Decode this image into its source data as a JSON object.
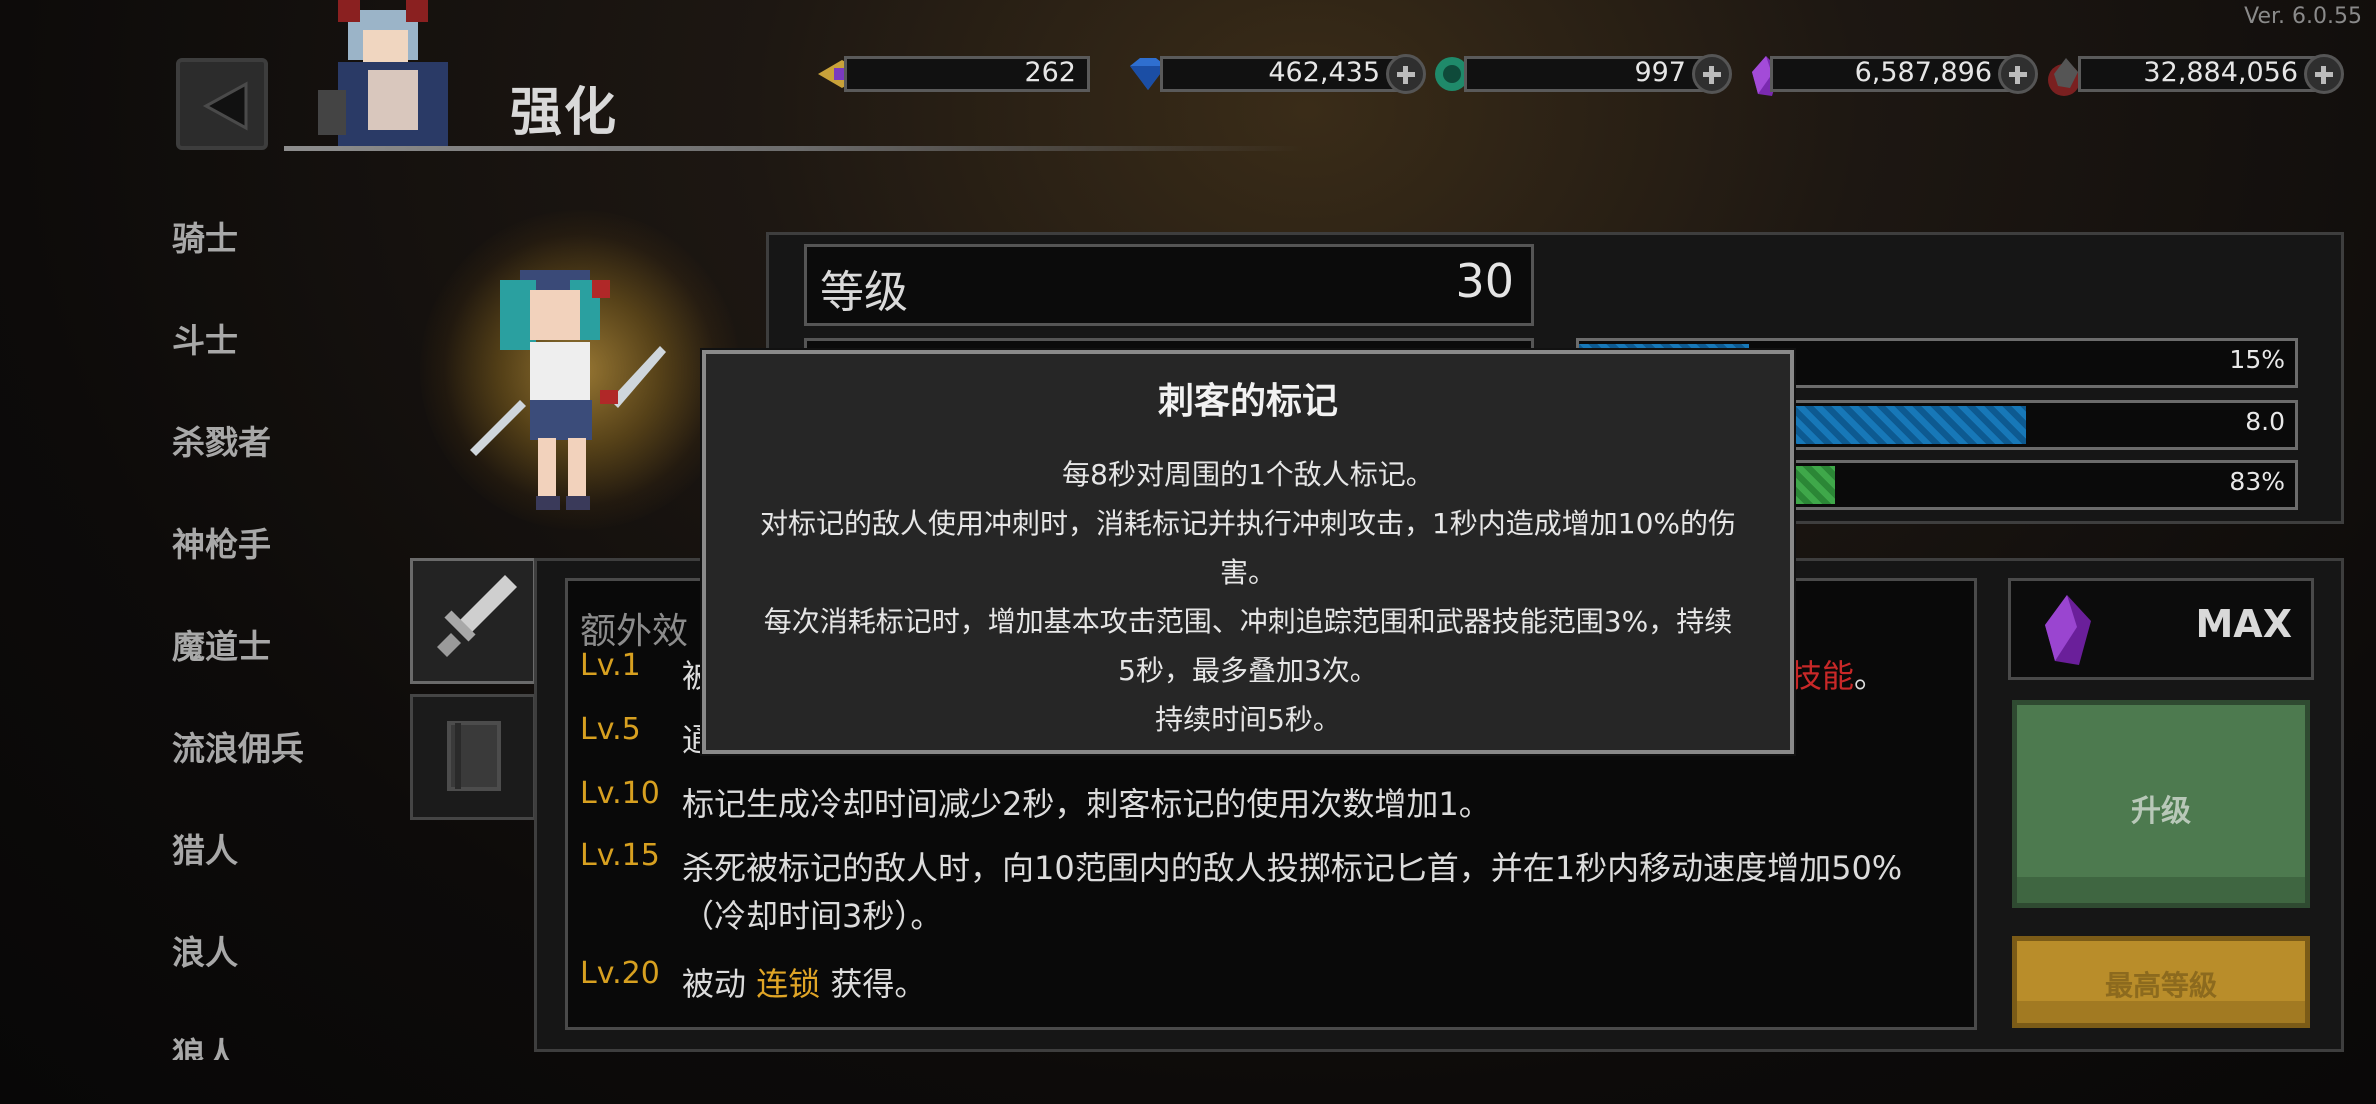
{
  "version": "Ver. 6.0.55",
  "header": {
    "title": "强化"
  },
  "currencies": [
    {
      "name": "ticket",
      "value": "262"
    },
    {
      "name": "gem",
      "value": "462,435"
    },
    {
      "name": "green-coin",
      "value": "997"
    },
    {
      "name": "purple-crystal",
      "value": "6,587,896"
    },
    {
      "name": "dark-ore",
      "value": "32,884,056"
    }
  ],
  "sidebar": {
    "items": [
      "骑士",
      "斗士",
      "杀戮者",
      "神枪手",
      "魔道士",
      "流浪佣兵",
      "猎人",
      "浪人",
      "狼人"
    ]
  },
  "stats": {
    "level_label": "等级",
    "level_value": "30",
    "bars": [
      {
        "value": "15%",
        "fill": 0.24
      },
      {
        "value": "8.0",
        "fill": 0.63
      },
      {
        "value": "83%",
        "fill": 0.2,
        "fill_green": 0.16
      }
    ]
  },
  "main": {
    "title": "额外效",
    "levels": [
      {
        "lv": "Lv.1",
        "text": "被",
        "tail_red": "技能",
        "tail_end": "。"
      },
      {
        "lv": "Lv.5",
        "text": "通"
      },
      {
        "lv": "Lv.10",
        "text": "标记生成冷却时间减少2秒，刺客标记的使用次数增加1。"
      },
      {
        "lv": "Lv.15",
        "text": "杀死被标记的敌人时，向10范围内的敌人投掷标记匕首，并在1秒内移动速度增加50%（冷却时间3秒）。"
      },
      {
        "lv": "Lv.20",
        "text_pre": "被动 ",
        "text_hl": "连锁",
        "text_post": " 获得。"
      }
    ],
    "max_label": "MAX",
    "upgrade_label": "升级",
    "max_level_label": "最高等級"
  },
  "tooltip": {
    "title": "刺客的标记",
    "lines": [
      "每8秒对周围的1个敌人标记。",
      "对标记的敌人使用冲刺时，消耗标记并执行冲刺攻击，1秒内造成增加10%的伤",
      "害。",
      "每次消耗标记时，增加基本攻击范围、冲刺追踪范围和武器技能范围3%，持续",
      "5秒，最多叠加3次。",
      "持续时间5秒。"
    ]
  },
  "colors": {
    "accent_gold": "#e0a526",
    "red": "#c82828",
    "upgrade_green": "#4d7a4f",
    "bar_blue": "#1778b8"
  }
}
